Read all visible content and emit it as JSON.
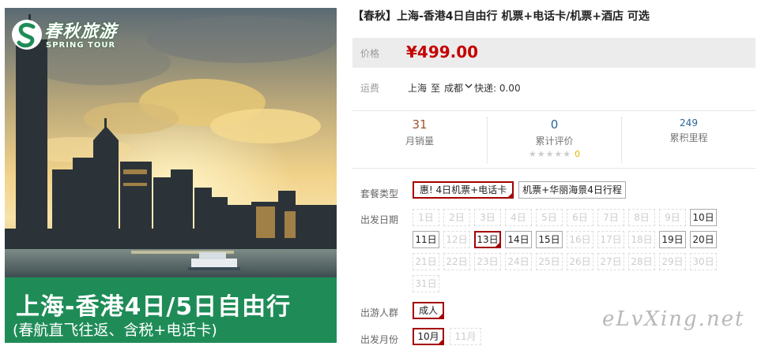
{
  "banner": {
    "brand_cn": "春秋旅游",
    "brand_en": "SPRING TOUR",
    "title": "上海-香港4日/5日自由行",
    "subtitle": "(春航直飞往返、含税+电话卡)",
    "strip_color": "#1f8c58"
  },
  "product": {
    "title": "【春秋】上海-香港4日自由行 机票+电话卡/机票+酒店 可选",
    "price_label": "价格",
    "price": "¥499.00",
    "price_color": "#c40000"
  },
  "shipping": {
    "label": "运费",
    "origin": "上海",
    "to": "至",
    "destination": "成都",
    "fee": "快递: 0.00"
  },
  "stats": {
    "sales_value": "31",
    "sales_label": "月销量",
    "reviews_value": "0",
    "reviews_label": "累计评价",
    "review_stars": "★★★★★",
    "review_star_count": "0",
    "miles_value": "249",
    "miles_label": "累积里程"
  },
  "options": {
    "package_label": "套餐类型",
    "packages": [
      {
        "label": "惠! 4日机票+电话卡",
        "state": "selected"
      },
      {
        "label": "机票+华丽海景4日行程",
        "state": "normal"
      }
    ],
    "date_label": "出发日期",
    "dates": [
      {
        "label": "1日",
        "state": "disabled"
      },
      {
        "label": "2日",
        "state": "disabled"
      },
      {
        "label": "3日",
        "state": "disabled"
      },
      {
        "label": "4日",
        "state": "disabled"
      },
      {
        "label": "5日",
        "state": "disabled"
      },
      {
        "label": "6日",
        "state": "disabled"
      },
      {
        "label": "7日",
        "state": "disabled"
      },
      {
        "label": "8日",
        "state": "disabled"
      },
      {
        "label": "9日",
        "state": "disabled"
      },
      {
        "label": "10日",
        "state": "normal"
      },
      {
        "label": "11日",
        "state": "normal"
      },
      {
        "label": "12日",
        "state": "disabled"
      },
      {
        "label": "13日",
        "state": "selected"
      },
      {
        "label": "14日",
        "state": "normal"
      },
      {
        "label": "15日",
        "state": "normal"
      },
      {
        "label": "16日",
        "state": "disabled"
      },
      {
        "label": "17日",
        "state": "disabled"
      },
      {
        "label": "18日",
        "state": "disabled"
      },
      {
        "label": "19日",
        "state": "normal"
      },
      {
        "label": "20日",
        "state": "normal"
      },
      {
        "label": "21日",
        "state": "disabled"
      },
      {
        "label": "22日",
        "state": "disabled"
      },
      {
        "label": "23日",
        "state": "disabled"
      },
      {
        "label": "24日",
        "state": "disabled"
      },
      {
        "label": "25日",
        "state": "disabled"
      },
      {
        "label": "26日",
        "state": "disabled"
      },
      {
        "label": "27日",
        "state": "disabled"
      },
      {
        "label": "28日",
        "state": "disabled"
      },
      {
        "label": "29日",
        "state": "disabled"
      },
      {
        "label": "30日",
        "state": "disabled"
      },
      {
        "label": "31日",
        "state": "disabled"
      }
    ],
    "crowd_label": "出游人群",
    "crowds": [
      {
        "label": "成人",
        "state": "selected"
      }
    ],
    "month_label": "出发月份",
    "months": [
      {
        "label": "10月",
        "state": "selected"
      },
      {
        "label": "11月",
        "state": "disabled"
      }
    ]
  },
  "watermark": "eLvXing.net"
}
